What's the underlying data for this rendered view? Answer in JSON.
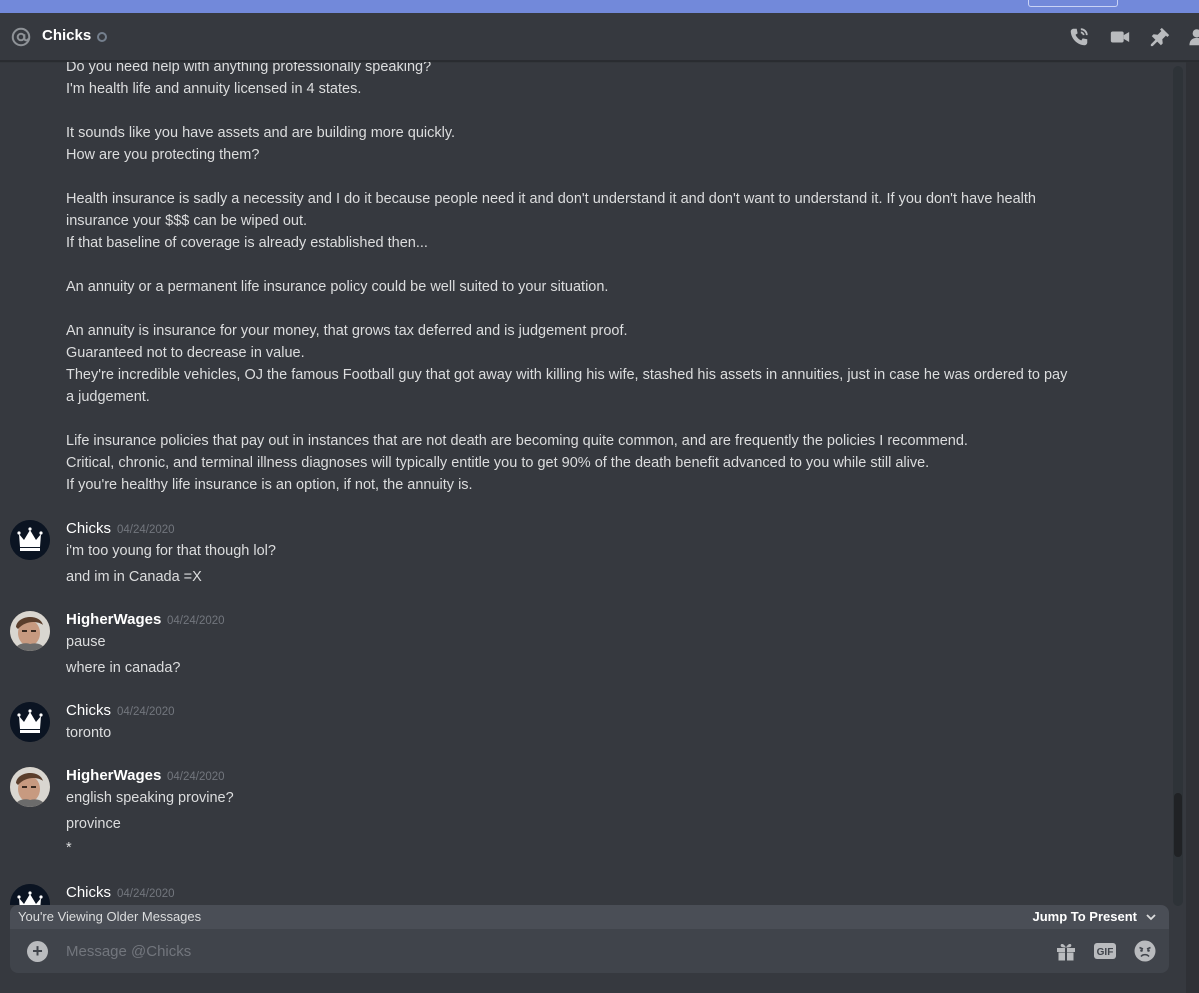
{
  "header": {
    "title": "Chicks",
    "icons": [
      "at-icon",
      "phone-call-icon",
      "video-icon",
      "pin-icon",
      "member-icon"
    ]
  },
  "messages": {
    "continued_lines": [
      "Do you need help with anything professionally speaking?",
      "I'm health life and annuity licensed in 4 states.",
      "It sounds like you have assets and are building more quickly.",
      "How are you protecting them?",
      "Health insurance is sadly a necessity and I do it because people need it and don't understand it and don't want to understand it. If you don't have health",
      "insurance your $$$ can be wiped out.",
      "If that baseline of coverage  is already established then...",
      "An annuity or a permanent life insurance policy could be well suited to your situation.",
      "An annuity is insurance for your money, that grows tax deferred and is judgement proof.",
      "Guaranteed not to decrease in value.",
      "They're incredible vehicles, OJ the famous Football guy that got away with killing his wife, stashed his assets in annuities, just in case he was ordered to pay",
      "a judgement.",
      "Life insurance policies that pay out in instances that are not death are becoming quite common, and are frequently the policies I recommend.",
      "Critical, chronic, and terminal illness diagnoses will typically entitle you to get 90% of the death benefit advanced to you while still alive.",
      "If you're healthy life insurance is an option, if not, the annuity is."
    ],
    "groups": [
      {
        "author": "Chicks",
        "timestamp": "04/24/2020",
        "lines": [
          "i'm too young for that though lol?",
          "and im in Canada =X"
        ]
      },
      {
        "author": "HigherWages",
        "timestamp": "04/24/2020",
        "lines": [
          "pause",
          "where in canada?"
        ]
      },
      {
        "author": "Chicks",
        "timestamp": "04/24/2020",
        "lines": [
          "toronto"
        ]
      },
      {
        "author": "HigherWages",
        "timestamp": "04/24/2020",
        "lines": [
          "english speaking provine?",
          "province",
          "*"
        ]
      },
      {
        "author": "Chicks",
        "timestamp": "04/24/2020",
        "lines": []
      }
    ]
  },
  "older_bar": {
    "text": "You're Viewing Older Messages",
    "jump_label": "Jump To Present"
  },
  "composer": {
    "placeholder": "Message @Chicks",
    "gif_label": "GIF"
  },
  "colors": {
    "background": "#36393f",
    "accent": "#7289da",
    "text": "#dcddde",
    "muted": "#72767d"
  }
}
